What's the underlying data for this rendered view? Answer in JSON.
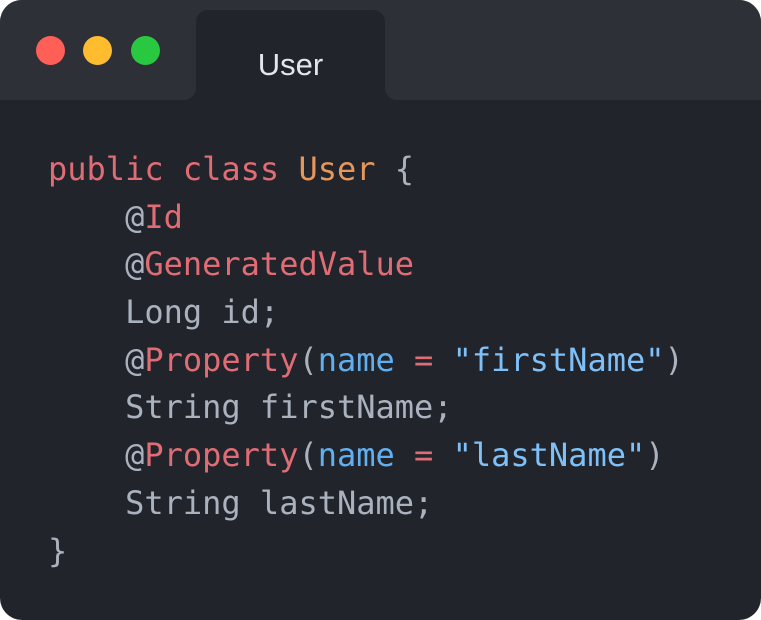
{
  "window": {
    "controls": {
      "close": "close-button",
      "minimize": "minimize-button",
      "maximize": "maximize-button"
    },
    "tab": {
      "title": "User"
    }
  },
  "colors": {
    "window_bg": "#21252b",
    "titlebar_bg": "#2d3036",
    "keyword": "#e06c75",
    "class_name": "#e5975c",
    "annotation": "#e06c75",
    "attribute": "#61afef",
    "string": "#7ec0f7",
    "plain_text": "#abb2bf"
  },
  "code": {
    "lines": [
      {
        "kw1": "public",
        "kw2": "class",
        "cls": "User",
        "brace": "{"
      },
      {
        "at": "@",
        "ann": "Id"
      },
      {
        "at": "@",
        "ann": "GeneratedValue"
      },
      {
        "plain": "Long id;"
      },
      {
        "at": "@",
        "ann": "Property",
        "open": "(",
        "attr": "name",
        "eq": "=",
        "str": "\"firstName\"",
        "close": ")"
      },
      {
        "plain": "String firstName;"
      },
      {
        "at": "@",
        "ann": "Property",
        "open": "(",
        "attr": "name",
        "eq": "=",
        "str": "\"lastName\"",
        "close": ")"
      },
      {
        "plain": "String lastName;"
      },
      {
        "brace": "}"
      }
    ]
  }
}
